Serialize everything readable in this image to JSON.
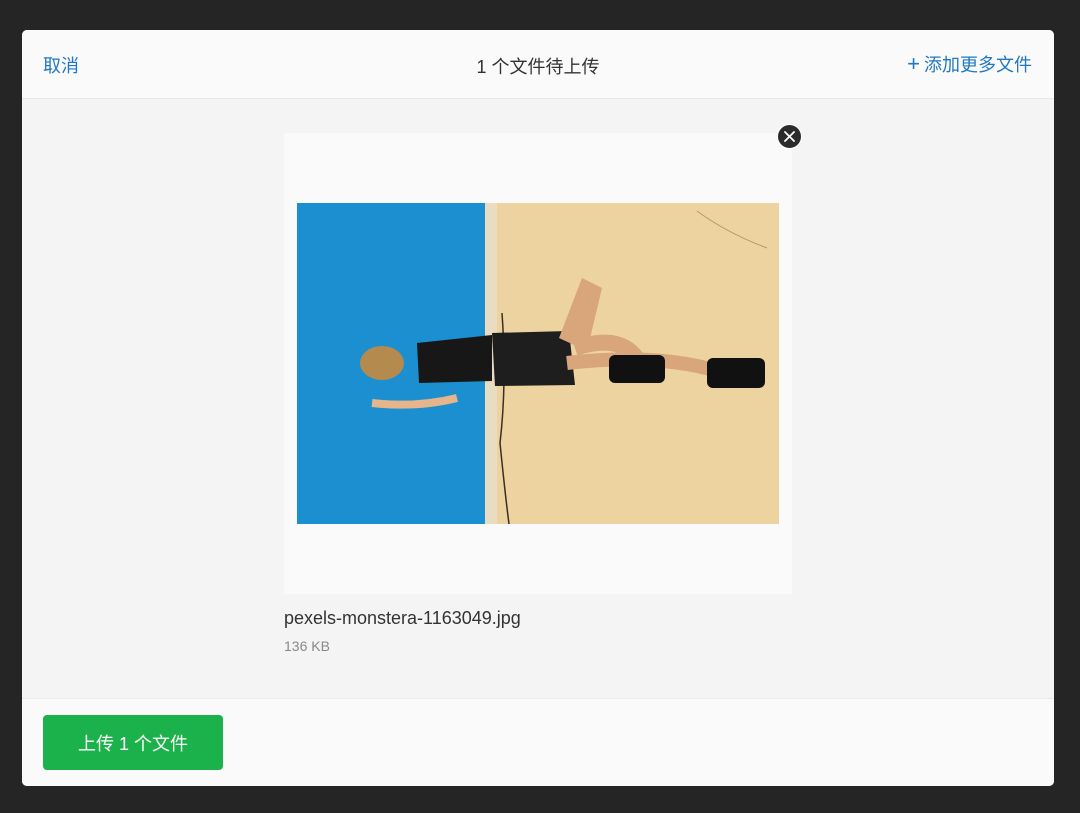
{
  "header": {
    "cancel_label": "取消",
    "title": "1 个文件待上传",
    "add_more_label": "添加更多文件",
    "add_more_icon": "plus-icon"
  },
  "file": {
    "name": "pexels-monstera-1163049.jpg",
    "size": "136 KB",
    "remove_icon": "close-icon"
  },
  "footer": {
    "upload_label": "上传 1 个文件"
  },
  "colors": {
    "accent_link": "#1f78c1",
    "upload_button": "#1bb24b",
    "backdrop": "#252525"
  }
}
